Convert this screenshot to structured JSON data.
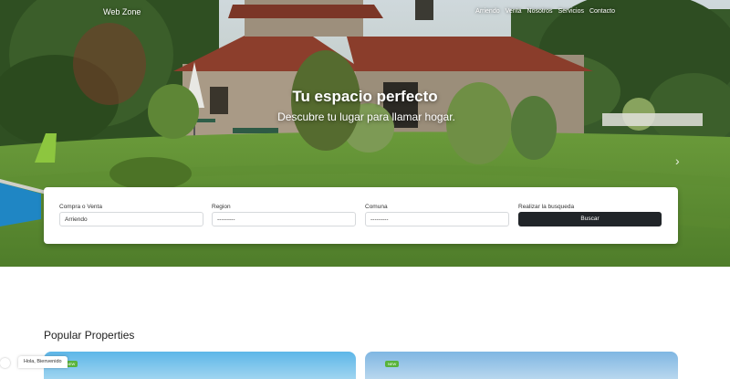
{
  "nav": {
    "brand": "Web Zone",
    "links": [
      "Arriendo",
      "Venta",
      "Nosotros",
      "Servicios",
      "Contacto"
    ]
  },
  "hero": {
    "title": "Tu espacio perfecto",
    "subtitle": "Descubre tu lugar para llamar hogar.",
    "next_icon": "chevron-right-icon"
  },
  "search": {
    "type_label": "Compra o Venta",
    "type_value": "Arriendo",
    "region_label": "Region",
    "region_value": "---------",
    "comuna_label": "Comuna",
    "comuna_value": "---------",
    "action_label": "Realizar la busqueda",
    "button_label": "Buscar"
  },
  "popular": {
    "title": "Popular Properties",
    "badge": "NEW"
  },
  "chat": {
    "greeting": "Hola, Bienvenido"
  }
}
